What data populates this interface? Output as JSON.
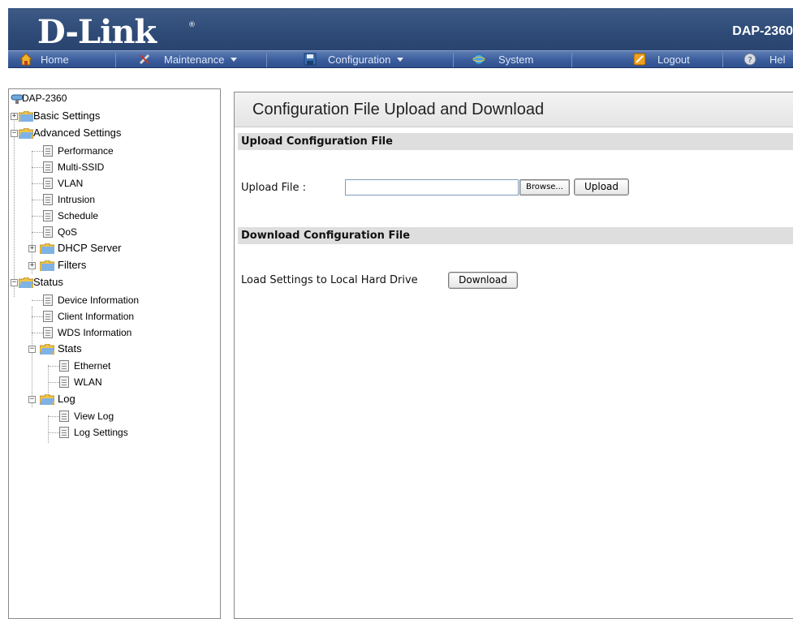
{
  "header": {
    "logo_text": "D-Link",
    "logo_reg": "®",
    "model": "DAP-2360"
  },
  "menubar": {
    "items": [
      {
        "label": "Home",
        "icon": "home-icon"
      },
      {
        "label": "Maintenance",
        "icon": "tools-icon",
        "dropdown": true
      },
      {
        "label": "Configuration",
        "icon": "floppy-disk-icon",
        "dropdown": true
      },
      {
        "label": "System",
        "icon": "system-icon"
      },
      {
        "label": "Logout",
        "icon": "logout-icon"
      },
      {
        "label": "Hel",
        "icon": "help-icon"
      }
    ]
  },
  "tree": {
    "root": "DAP-2360",
    "basic_settings": "Basic Settings",
    "advanced_settings": "Advanced Settings",
    "advanced_children": [
      "Performance",
      "Multi-SSID",
      "VLAN",
      "Intrusion",
      "Schedule",
      "QoS"
    ],
    "dhcp_server": "DHCP Server",
    "filters": "Filters",
    "status": "Status",
    "status_children": [
      "Device Information",
      "Client Information",
      "WDS Information"
    ],
    "stats": "Stats",
    "stats_children": [
      "Ethernet",
      "WLAN"
    ],
    "log": "Log",
    "log_children": [
      "View Log",
      "Log Settings"
    ]
  },
  "main": {
    "title": "Configuration File Upload and Download",
    "upload_section": "Upload Configuration File",
    "upload_label": "Upload File :",
    "upload_value": "",
    "browse_label": "Browse...",
    "upload_button": "Upload",
    "download_section": "Download Configuration File",
    "download_label": "Load Settings to Local Hard Drive",
    "download_button": "Download"
  },
  "colors": {
    "header_bg": "#2e4a76",
    "menubar_bg": "#3d5f9e",
    "section_bar": "#dedede"
  }
}
